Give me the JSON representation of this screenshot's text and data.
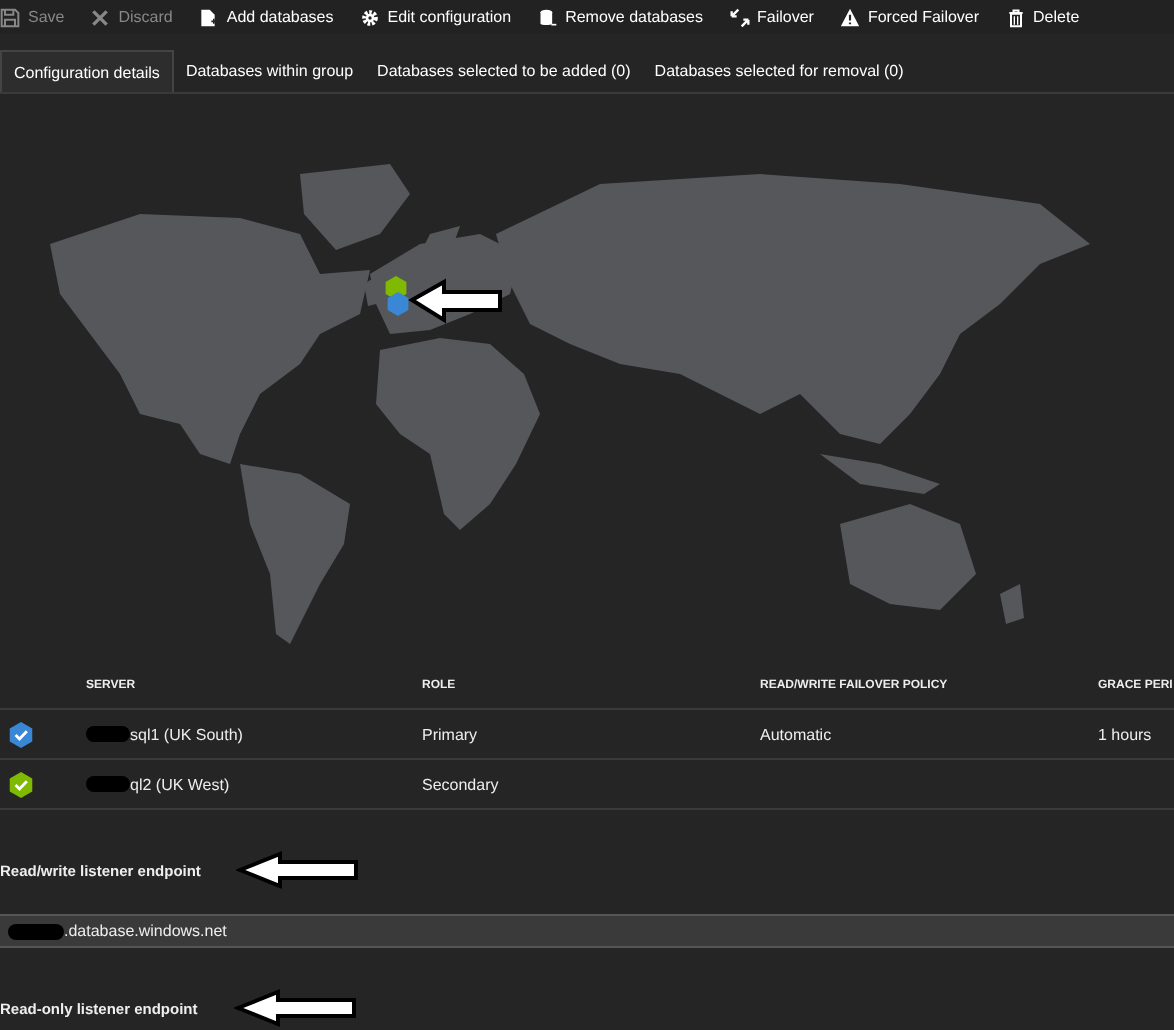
{
  "toolbar": [
    {
      "label": "Save",
      "kind": "save",
      "disabled": true
    },
    {
      "label": "Discard",
      "kind": "discard",
      "disabled": true
    },
    {
      "label": "Add databases",
      "kind": "add",
      "disabled": false
    },
    {
      "label": "Edit configuration",
      "kind": "gear",
      "disabled": false
    },
    {
      "label": "Remove databases",
      "kind": "remove",
      "disabled": false
    },
    {
      "label": "Failover",
      "kind": "failover",
      "disabled": false
    },
    {
      "label": "Forced Failover",
      "kind": "warning",
      "disabled": false
    },
    {
      "label": "Delete",
      "kind": "trash",
      "disabled": false
    }
  ],
  "tabs": [
    {
      "label": "Configuration details",
      "selected": true
    },
    {
      "label": "Databases within group",
      "selected": false
    },
    {
      "label": "Databases selected to be added (0)",
      "selected": false
    },
    {
      "label": "Databases selected for removal (0)",
      "selected": false
    }
  ],
  "map": {
    "markers": [
      {
        "color": "#7fba00"
      },
      {
        "color": "#3a87d6"
      }
    ]
  },
  "table": {
    "columns": [
      "SERVER",
      "ROLE",
      "READ/WRITE FAILOVER POLICY",
      "GRACE PERI"
    ],
    "rows": [
      {
        "color": "#3a87d6",
        "cells": [
          "sql1 (UK South)",
          "Primary",
          "Automatic",
          "1 hours"
        ]
      },
      {
        "color": "#7fba00",
        "cells": [
          "ql2 (UK West)",
          "Secondary"
        ]
      }
    ]
  },
  "rw_endpoint": {
    "label": "Read/write listener endpoint",
    "value": ".database.windows.net"
  },
  "ro_endpoint": {
    "label": "Read-only listener endpoint"
  }
}
